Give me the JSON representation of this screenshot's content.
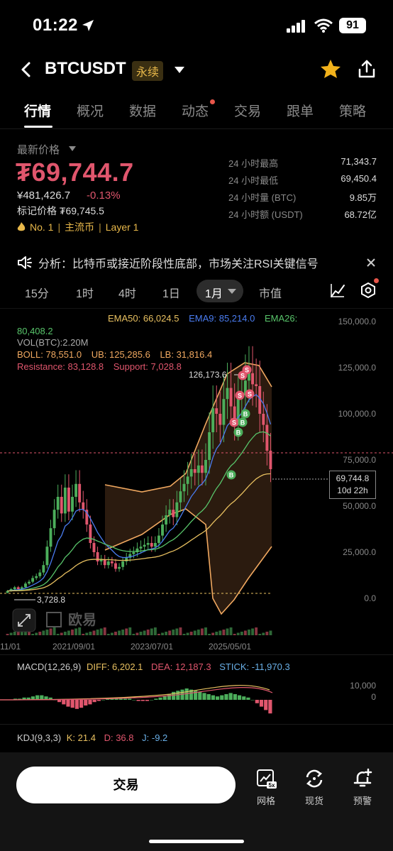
{
  "status_bar": {
    "time": "01:22",
    "battery": "91"
  },
  "header": {
    "symbol": "BTCUSDT",
    "badge": "永续"
  },
  "tabs": [
    "行情",
    "概况",
    "数据",
    "动态",
    "交易",
    "跟单",
    "策略"
  ],
  "price": {
    "label": "最新价格",
    "last": "₮69,744.7",
    "cny": "¥481,426.7",
    "change_pct": "-0.13%",
    "mark": "标记价格 ₮69,745.5",
    "rank": "No. 1",
    "tag1": "主流币",
    "tag2": "Layer 1",
    "separator": "|"
  },
  "stats": [
    {
      "label": "24 小时最高",
      "value": "71,343.7"
    },
    {
      "label": "24 小时最低",
      "value": "69,450.4"
    },
    {
      "label": "24 小时量 (BTC)",
      "value": "9.85万"
    },
    {
      "label": "24 小时额 (USDT)",
      "value": "68.72亿"
    }
  ],
  "analysis": {
    "text": "分析：比特币或接近阶段性底部，市场关注RSI关键信号"
  },
  "intervals": [
    "15分",
    "1时",
    "4时",
    "1日",
    "1月",
    "市值"
  ],
  "active_interval": "1月",
  "chart_legend": {
    "ema50": "EMA50: 66,024.5",
    "ema9": "EMA9: 85,214.0",
    "ema26_a": "EMA26:",
    "ema26_b": "80,408.2",
    "vol": "VOL(BTC):2.20M",
    "boll": "BOLL: 78,551.0",
    "ub": "UB: 125,285.6",
    "lb": "LB: 31,816.4",
    "resistance": "Resistance: 83,128.8",
    "support": "Support: 7,028.8",
    "high_marker": "126,173.6",
    "low_marker": "3,728.8",
    "price_tag_value": "69,744.8",
    "price_tag_time": "10d 22h",
    "watermark": "欧易"
  },
  "chart_data": {
    "type": "line",
    "y_axis_labels": [
      "150,000.0",
      "125,000.0",
      "100,000.0",
      "75,000.0",
      "50,000.0",
      "25,000.0",
      "0.0"
    ],
    "x_axis_labels": [
      "11/01",
      "2021/09/01",
      "2023/07/01",
      "2025/05/01"
    ],
    "ylim": [
      0,
      150000
    ],
    "signal_labels": [
      "S",
      "S",
      "S",
      "S",
      "S",
      "B",
      "B",
      "B",
      "B"
    ]
  },
  "macd": {
    "title": "MACD(12,26,9)",
    "diff": "DIFF: 6,202.1",
    "dea": "DEA: 12,187.3",
    "stick": "STICK: -11,970.3",
    "axis_top": "10,000",
    "axis_zero": "0"
  },
  "kdj": {
    "title": "KDJ(9,3,3)",
    "k": "K: 21.4",
    "d": "D: 36.8",
    "j": "J: -9.2"
  },
  "bottom_bar": {
    "trade": "交易",
    "grid": "网格",
    "spot": "现货",
    "alert": "预警",
    "grid_badge": "5x"
  },
  "colors": {
    "up": "#4cae5b",
    "down": "#e0566d",
    "ema50": "#e8c060",
    "ema9": "#4a7cf0",
    "ema26": "#58c46a",
    "boll": "#f0a860",
    "accent": "#e8b84a"
  }
}
